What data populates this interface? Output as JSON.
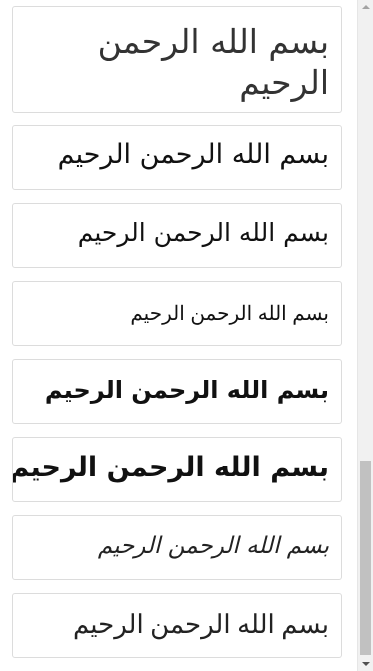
{
  "font_samples": [
    {
      "text": "بسم الله الرحمن الرحيم"
    },
    {
      "text": "بسم الله الرحمن الرحيم"
    },
    {
      "text": "بسم الله الرحمن الرحيم"
    },
    {
      "text": "بسم الله الرحمن الرحيم"
    },
    {
      "text": "بسم الله الرحمن الرحيم"
    },
    {
      "text": "بسم الله الرحمن الرحيم"
    },
    {
      "text": "بسم الله الرحمن الرحيم"
    },
    {
      "text": "بسم الله الرحمن الرحيم"
    }
  ],
  "scrollbar": {
    "position_fraction": 0.95
  },
  "colors": {
    "card_border": "#dcdcdc",
    "text": "#111111",
    "scroll_track": "#f1f1f1",
    "scroll_thumb": "#c1c1c1"
  }
}
